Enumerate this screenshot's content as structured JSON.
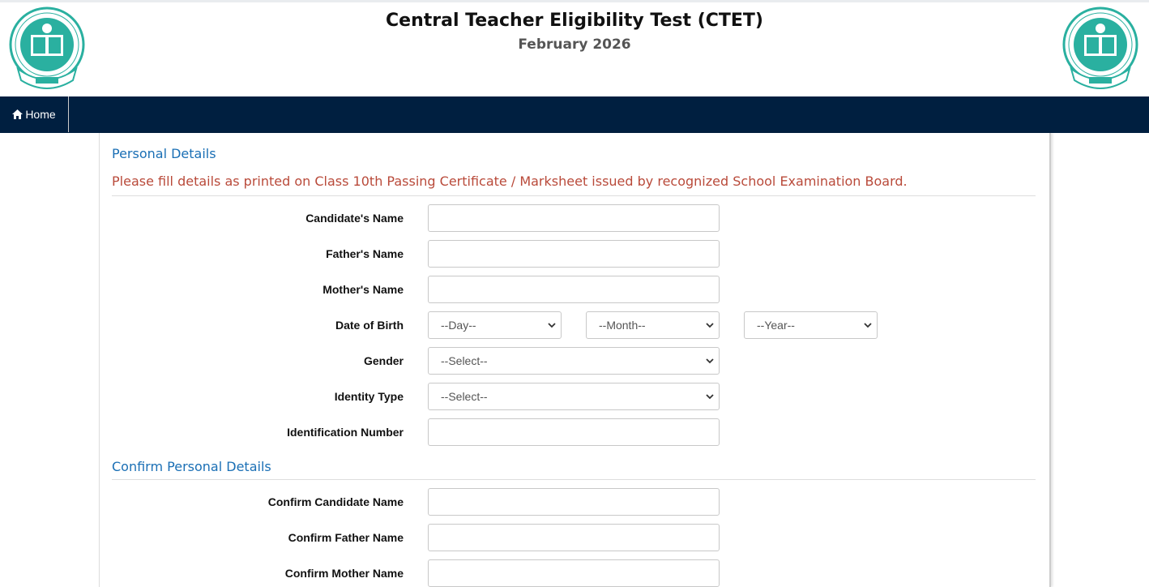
{
  "header": {
    "title": "Central Teacher Eligibility Test (CTET)",
    "subtitle": "February 2026",
    "logo_icon": "cbse-emblem-icon"
  },
  "nav": {
    "home_label": "Home",
    "home_icon": "home-icon"
  },
  "form": {
    "section_personal": "Personal Details",
    "note": "Please fill details as printed on Class 10th Passing Certificate / Marksheet issued by recognized School Examination Board.",
    "labels": {
      "candidate_name": "Candidate's Name",
      "father_name": "Father's Name",
      "mother_name": "Mother's Name",
      "dob": "Date of Birth",
      "gender": "Gender",
      "identity_type": "Identity Type",
      "identification_number": "Identification Number"
    },
    "dob": {
      "day": "--Day--",
      "month": "--Month--",
      "year": "--Year--"
    },
    "gender_selected": "--Select--",
    "identity_selected": "--Select--",
    "section_confirm": "Confirm Personal Details",
    "confirm_labels": {
      "candidate": "Confirm Candidate Name",
      "father": "Confirm Father Name",
      "mother": "Confirm Mother Name"
    }
  },
  "colors": {
    "navbar": "#001f40",
    "section_title": "#1a6fb5",
    "note": "#b94a3a",
    "emblem": "#2ab0a0"
  }
}
